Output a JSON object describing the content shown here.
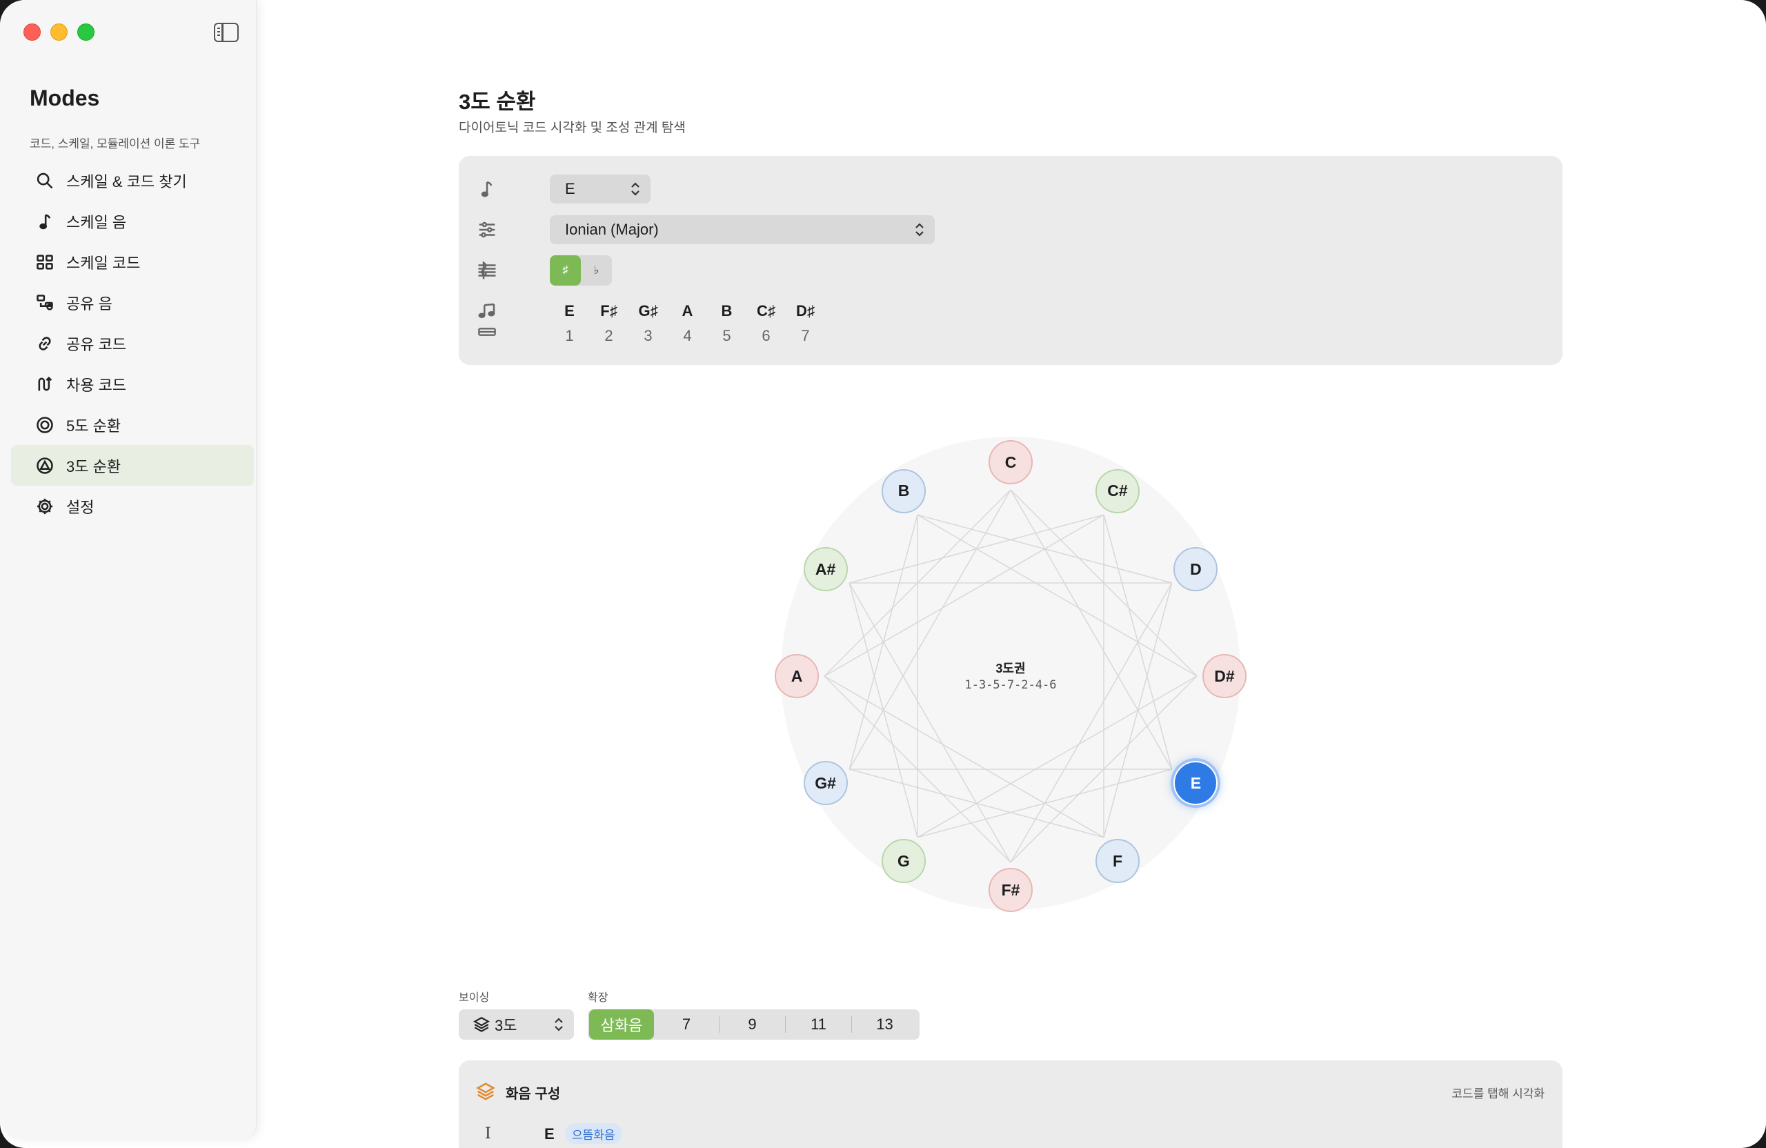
{
  "sidebar": {
    "app_title": "Modes",
    "app_subtitle": "코드, 스케일, 모듈레이션 이론 도구",
    "items": [
      {
        "label": "스케일 & 코드 찾기"
      },
      {
        "label": "스케일 음"
      },
      {
        "label": "스케일 코드"
      },
      {
        "label": "공유 음"
      },
      {
        "label": "공유 코드"
      },
      {
        "label": "차용 코드"
      },
      {
        "label": "5도 순환"
      },
      {
        "label": "3도 순환",
        "active": true
      },
      {
        "label": "설정"
      }
    ]
  },
  "page": {
    "title": "3도 순환",
    "subtitle": "다이어토닉 코드 시각화 및 조성 관계 탐색"
  },
  "controls": {
    "key_value": "E",
    "mode_value": "Ionian (Major)",
    "accidental_sharp": "♯",
    "accidental_flat": "♭",
    "accidental_selected": "sharp",
    "scale_notes": [
      {
        "name": "E",
        "degree": "1"
      },
      {
        "name": "F♯",
        "degree": "2"
      },
      {
        "name": "G♯",
        "degree": "3"
      },
      {
        "name": "A",
        "degree": "4"
      },
      {
        "name": "B",
        "degree": "5"
      },
      {
        "name": "C♯",
        "degree": "6"
      },
      {
        "name": "D♯",
        "degree": "7"
      }
    ]
  },
  "circle": {
    "center_title": "3도권",
    "center_sequence": "1-3-5-7-2-4-6",
    "active_note": "E",
    "nodes": [
      {
        "label": "C",
        "color": "pink"
      },
      {
        "label": "C#",
        "color": "green"
      },
      {
        "label": "D",
        "color": "blue"
      },
      {
        "label": "D#",
        "color": "pink"
      },
      {
        "label": "E",
        "color": "active"
      },
      {
        "label": "F",
        "color": "blue"
      },
      {
        "label": "F#",
        "color": "pink"
      },
      {
        "label": "G",
        "color": "green"
      },
      {
        "label": "G#",
        "color": "blue"
      },
      {
        "label": "A",
        "color": "pink"
      },
      {
        "label": "A#",
        "color": "green"
      },
      {
        "label": "B",
        "color": "blue"
      }
    ]
  },
  "bottom": {
    "voicing_label": "보이싱",
    "voicing_value": "3도",
    "extension_label": "확장",
    "extensions": [
      "삼화음",
      "7",
      "9",
      "11",
      "13"
    ],
    "extension_selected": "삼화음"
  },
  "harmony": {
    "title": "화음 구성",
    "hint": "코드를 탭해 시각화",
    "first_row": {
      "numeral": "I",
      "root": "E",
      "badge": "으뜸화음"
    }
  },
  "colors": {
    "accent_green": "#7dba55",
    "active_blue": "#2f7be6",
    "sidebar_active": "#e8efe2"
  }
}
